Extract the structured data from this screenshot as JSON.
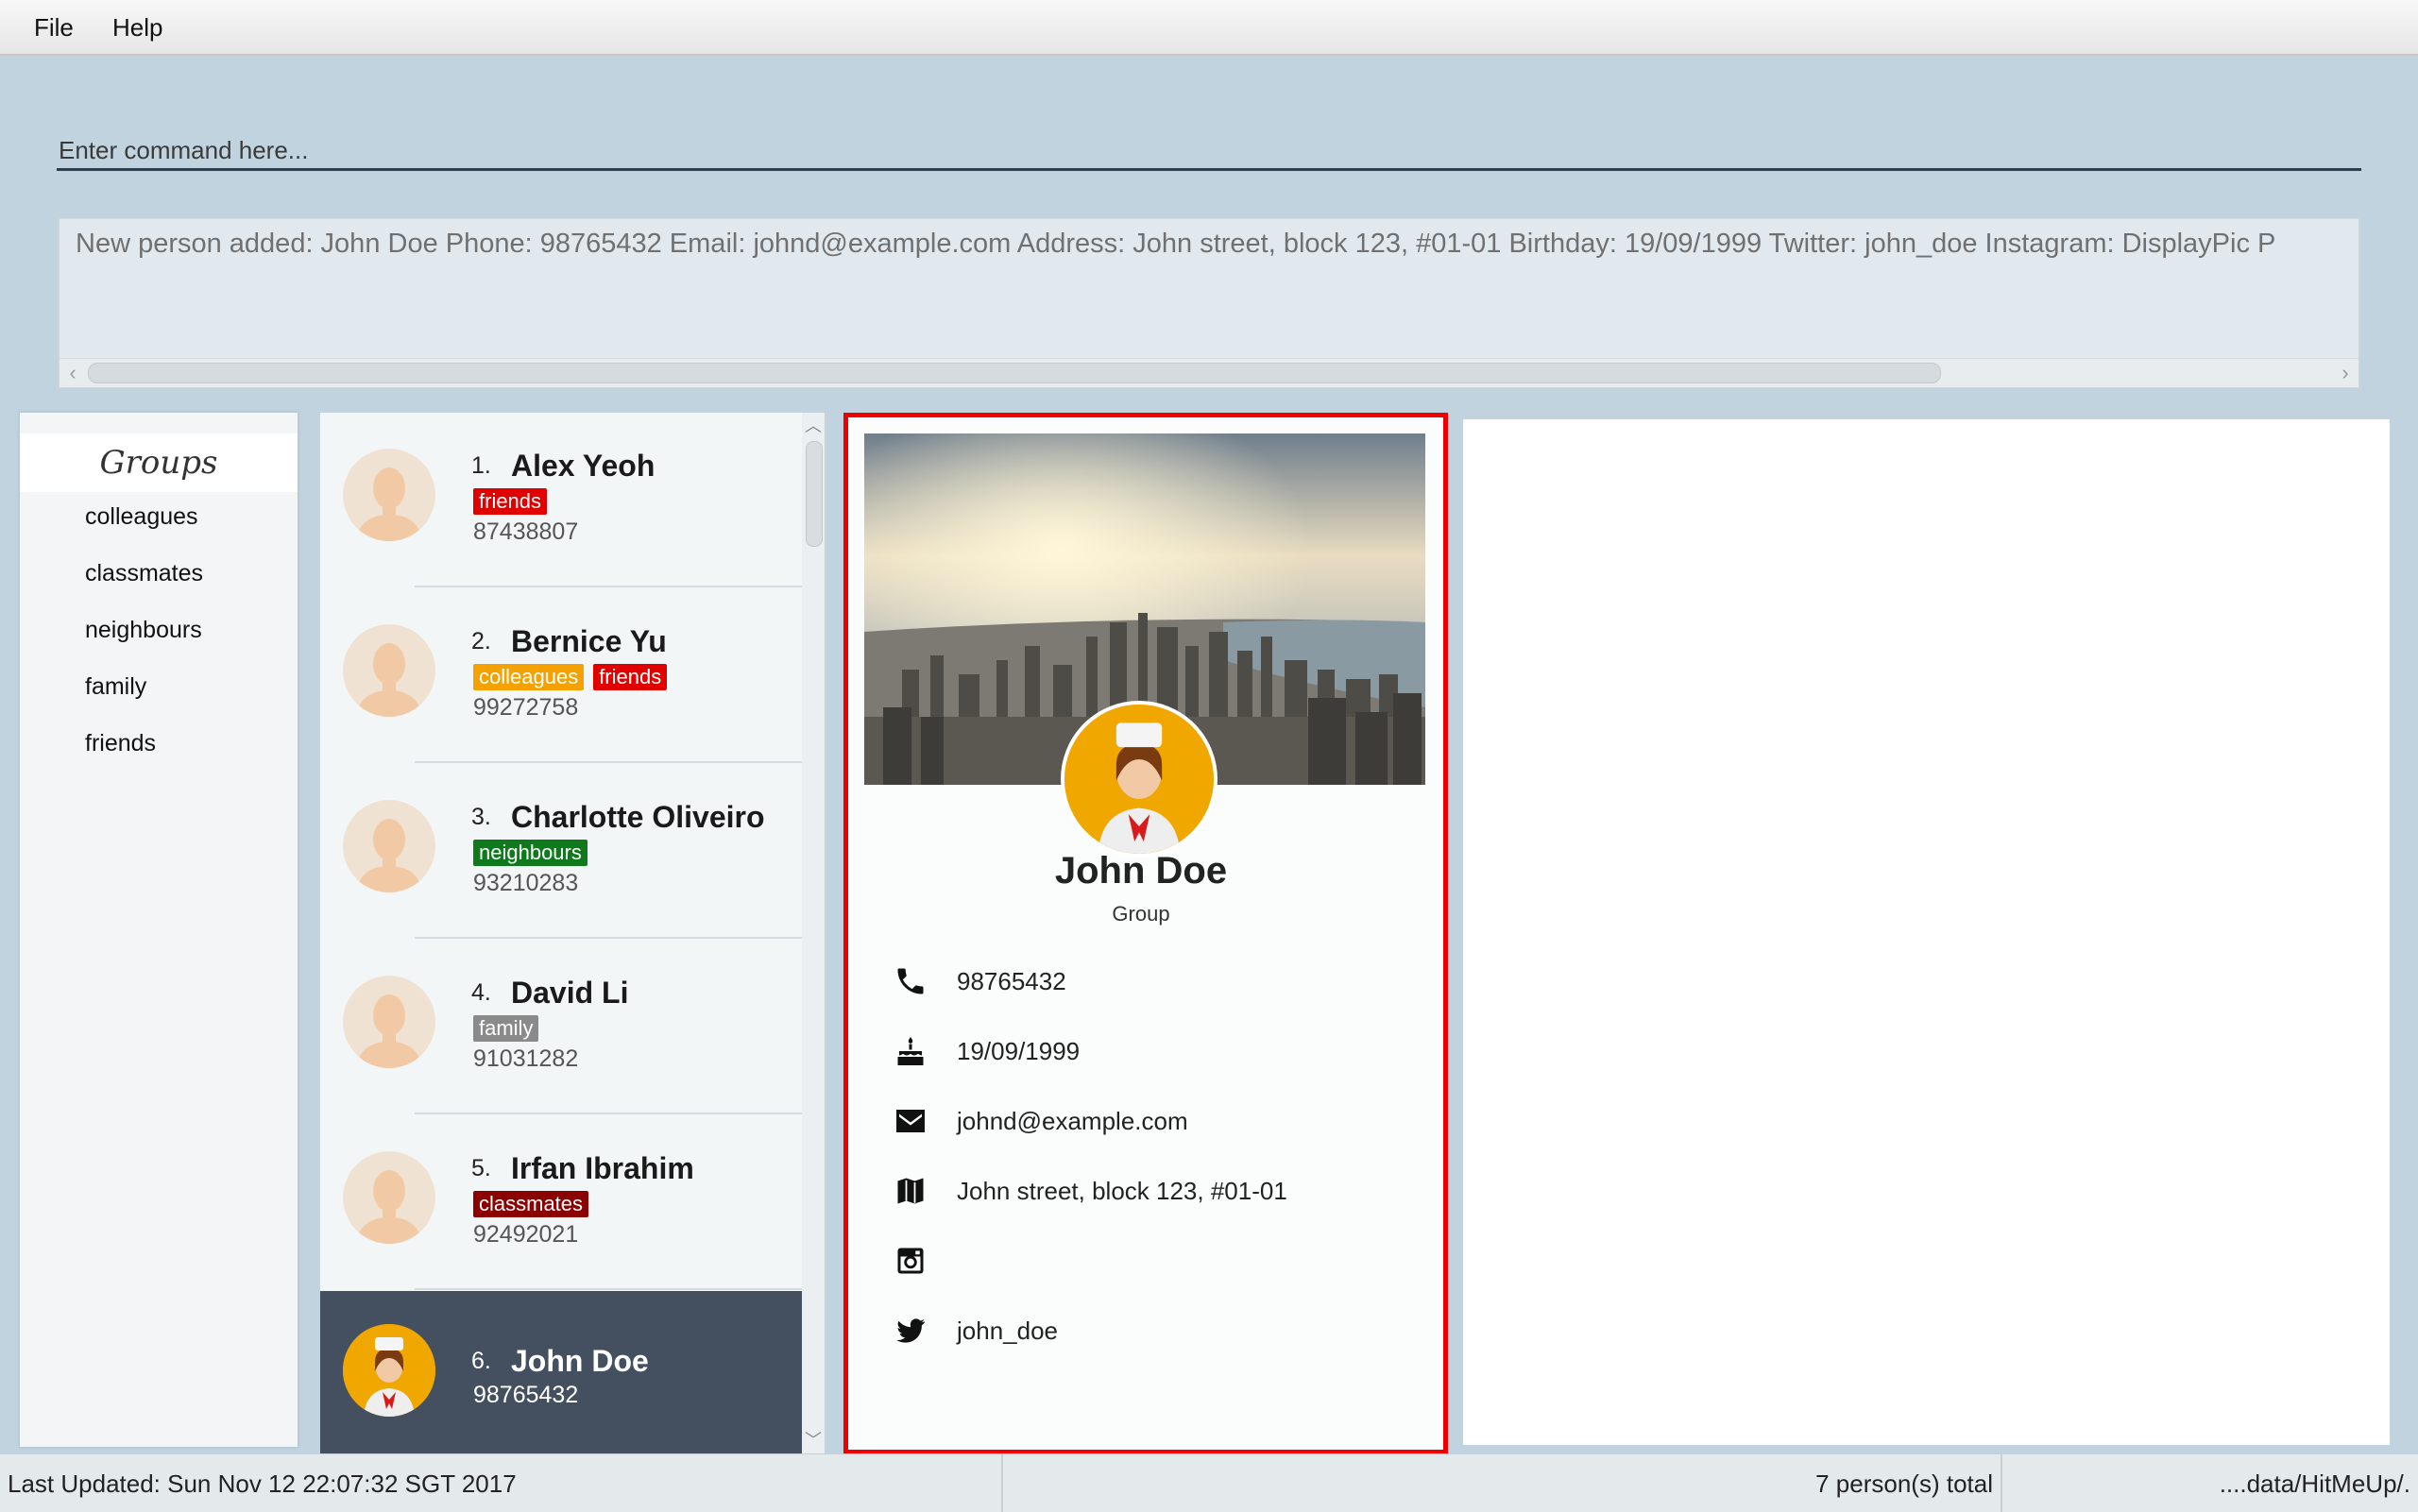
{
  "menu": {
    "file": "File",
    "help": "Help"
  },
  "command": {
    "placeholder": "Enter command here..."
  },
  "result": {
    "text": "New person added: John Doe Phone: 98765432 Email: johnd@example.com Address: John street, block 123, #01-01 Birthday: 19/09/1999 Twitter: john_doe Instagram:  DisplayPic P"
  },
  "groups": {
    "title": "Groups",
    "items": [
      "colleagues",
      "classmates",
      "neighbours",
      "family",
      "friends"
    ]
  },
  "persons": [
    {
      "index": "1.",
      "name": "Alex Yeoh",
      "phone": "87438807",
      "tags": [
        {
          "label": "friends",
          "color": "#e00000"
        }
      ]
    },
    {
      "index": "2.",
      "name": "Bernice Yu",
      "phone": "99272758",
      "tags": [
        {
          "label": "colleagues",
          "color": "#f5a200"
        },
        {
          "label": "friends",
          "color": "#e00000"
        }
      ]
    },
    {
      "index": "3.",
      "name": "Charlotte Oliveiro",
      "phone": "93210283",
      "tags": [
        {
          "label": "neighbours",
          "color": "#0f7a1c"
        }
      ]
    },
    {
      "index": "4.",
      "name": "David Li",
      "phone": "91031282",
      "tags": [
        {
          "label": "family",
          "color": "#8a8a8a"
        }
      ]
    },
    {
      "index": "5.",
      "name": "Irfan Ibrahim",
      "phone": "92492021",
      "tags": [
        {
          "label": "classmates",
          "color": "#8b0000"
        }
      ]
    },
    {
      "index": "6.",
      "name": "John Doe",
      "phone": "98765432",
      "tags": [],
      "selected": true
    }
  ],
  "profile": {
    "name": "John Doe",
    "group": "Group",
    "phone": "98765432",
    "birthday": "19/09/1999",
    "email": "johnd@example.com",
    "address": "John street, block 123, #01-01",
    "instagram": "",
    "twitter": "john_doe",
    "icons": [
      "phone-icon",
      "birthday-cake-icon",
      "email-icon",
      "map-icon",
      "instagram-icon",
      "twitter-icon"
    ]
  },
  "status": {
    "last_updated": "Last Updated: Sun Nov 12 22:07:32 SGT 2017",
    "total": "7 person(s) total",
    "path": "....data/HitMeUp/."
  },
  "colors": {
    "highlight_border": "#ee0000",
    "selected_card": "#44505f",
    "background": "#c0d3df"
  }
}
